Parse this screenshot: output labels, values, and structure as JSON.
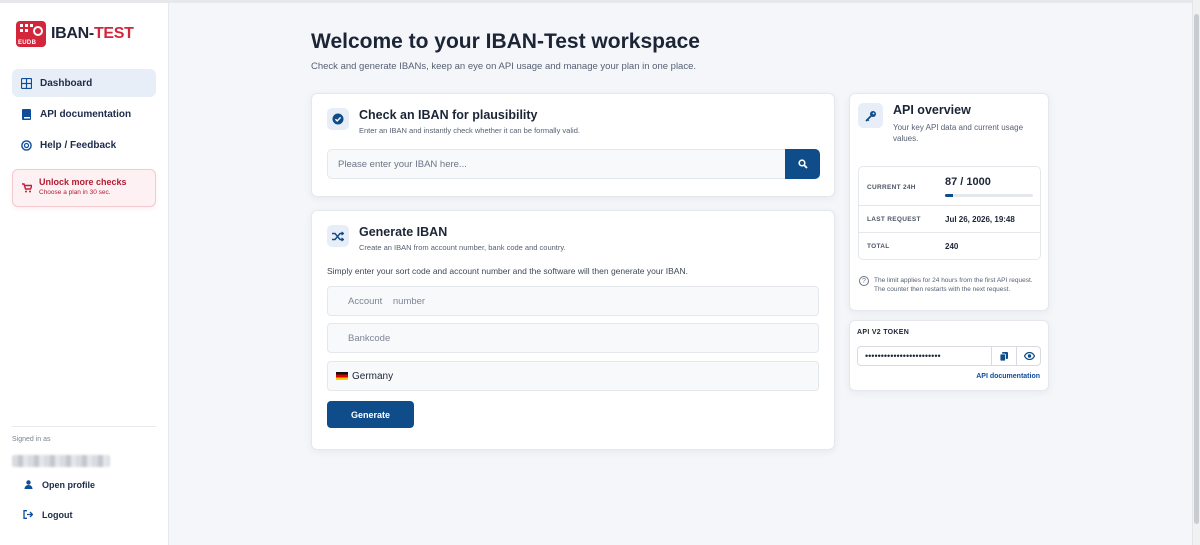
{
  "brand": {
    "badge_text": "EUDB",
    "name_part1": "IBAN-",
    "name_part2": "TEST"
  },
  "nav": {
    "dashboard": "Dashboard",
    "api_docs": "API documentation",
    "help": "Help / Feedback"
  },
  "upsell": {
    "title": "Unlock more checks",
    "subtitle": "Choose a plan in 30 sec."
  },
  "account": {
    "signed_in_label": "Signed in as",
    "open_profile": "Open profile",
    "logout": "Logout"
  },
  "header": {
    "title": "Welcome to your IBAN-Test workspace",
    "subtitle": "Check and generate IBANs, keep an eye on API usage and manage your plan in one place."
  },
  "check_card": {
    "title": "Check an IBAN for plausibility",
    "subtitle": "Enter an IBAN and instantly check whether it can be formally valid.",
    "placeholder": "Please enter your IBAN here..."
  },
  "generate_card": {
    "title": "Generate IBAN",
    "subtitle": "Create an IBAN from account number, bank code and country.",
    "description": "Simply enter your sort code and account number and the software will then generate your IBAN.",
    "account_placeholder": "Account    number",
    "bankcode_placeholder": "Bankcode",
    "country": "Germany",
    "button": "Generate"
  },
  "api_overview": {
    "title": "API overview",
    "subtitle": "Your key API data and current usage values.",
    "current_label": "CURRENT 24H",
    "current_value": "87 / 1000",
    "current_fraction": 0.087,
    "last_request_label": "LAST REQUEST",
    "last_request_value": "Jul 26, 2026, 19:48",
    "total_label": "TOTAL",
    "total_value": "240",
    "note": "The limit applies for 24 hours from the first API request. The counter then restarts with the next request."
  },
  "token": {
    "label": "API V2 TOKEN",
    "masked": "••••••••••••••••••••••••",
    "docs_link": "API documentation"
  },
  "colors": {
    "primary": "#0f4c8a",
    "brand_red": "#d3263a",
    "active_nav_bg": "#e8eef7"
  }
}
